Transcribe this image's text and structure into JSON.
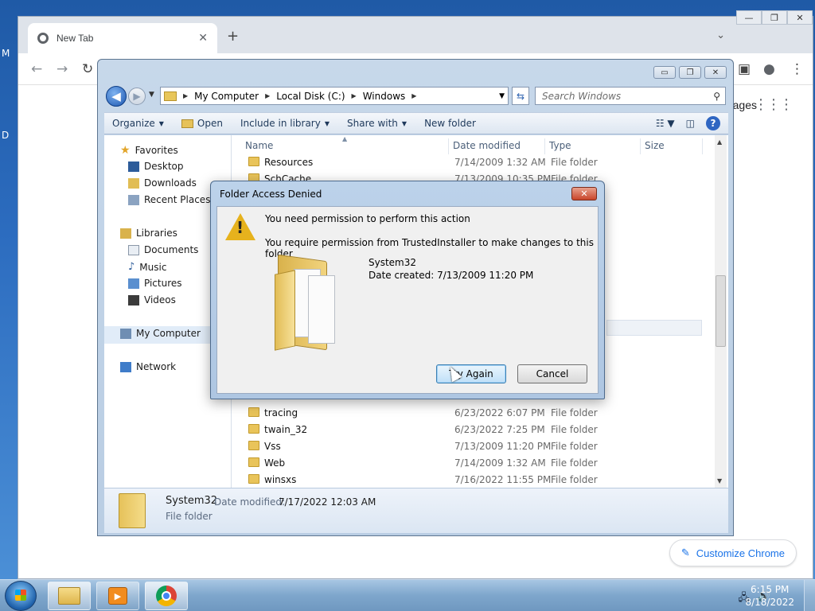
{
  "desktop": {
    "glyph_m": "M",
    "glyph_d": "D"
  },
  "chrome": {
    "tab_title": "New Tab",
    "tab_close": "✕",
    "new_tab": "+",
    "tab_menu": "⌄",
    "ntp_images_fragment": "ages",
    "apps_icon": "⋮⋮⋮",
    "customize_label": "Customize Chrome",
    "customize_icon": "✎",
    "back": "←",
    "forward": "→",
    "reload": "↻",
    "winctl": {
      "min": "—",
      "max": "❐",
      "close": "✕"
    },
    "toolbar_right": {
      "sidepanel": "▣",
      "profile": "●",
      "menu": "⋮"
    }
  },
  "explorer": {
    "winctl": {
      "min": "▭",
      "max": "❐",
      "close": "✕"
    },
    "back": "◀",
    "forward": "▶",
    "breadcrumb": [
      "My Computer",
      "Local Disk (C:)",
      "Windows"
    ],
    "search_placeholder": "Search Windows",
    "toolbar": {
      "organize": "Organize",
      "open": "Open",
      "include_in_library": "Include in library",
      "share_with": "Share with",
      "new_folder": "New folder"
    },
    "nav": {
      "favorites": "Favorites",
      "desktop": "Desktop",
      "downloads": "Downloads",
      "recent_places": "Recent Places",
      "libraries": "Libraries",
      "documents": "Documents",
      "music": "Music",
      "pictures": "Pictures",
      "videos": "Videos",
      "my_computer": "My Computer",
      "network": "Network"
    },
    "columns": {
      "name": "Name",
      "date": "Date modified",
      "type": "Type",
      "size": "Size"
    },
    "rows_top": [
      {
        "name": "Resources",
        "date": "7/14/2009 1:32 AM",
        "type": "File folder"
      },
      {
        "name": "SchCache",
        "date": "7/13/2009 10:35 PM",
        "type": "File folder"
      }
    ],
    "rows_bottom": [
      {
        "name": "tracing",
        "date": "6/23/2022 6:07 PM",
        "type": "File folder"
      },
      {
        "name": "twain_32",
        "date": "6/23/2022 7:25 PM",
        "type": "File folder"
      },
      {
        "name": "Vss",
        "date": "7/13/2009 11:20 PM",
        "type": "File folder"
      },
      {
        "name": "Web",
        "date": "7/14/2009 1:32 AM",
        "type": "File folder"
      },
      {
        "name": "winsxs",
        "date": "7/16/2022 11:55 PM",
        "type": "File folder"
      }
    ],
    "details": {
      "name": "System32",
      "modified_label": "Date modified:",
      "modified_value": "7/17/2022 12:03 AM",
      "type": "File folder"
    }
  },
  "dialog": {
    "title": "Folder Access Denied",
    "close": "✕",
    "warn_mark": "!",
    "message1": "You need permission to perform this action",
    "message2": "You require permission from TrustedInstaller to make changes to this folder",
    "folder_name": "System32",
    "folder_date": "Date created: 7/13/2009 11:20 PM",
    "try_again": "Try Again",
    "cancel": "Cancel"
  },
  "taskbar": {
    "media_icon": "▶",
    "time": "6:15 PM",
    "date": "8/18/2022",
    "tray_network": "🖧",
    "tray_volume": "🔊"
  }
}
